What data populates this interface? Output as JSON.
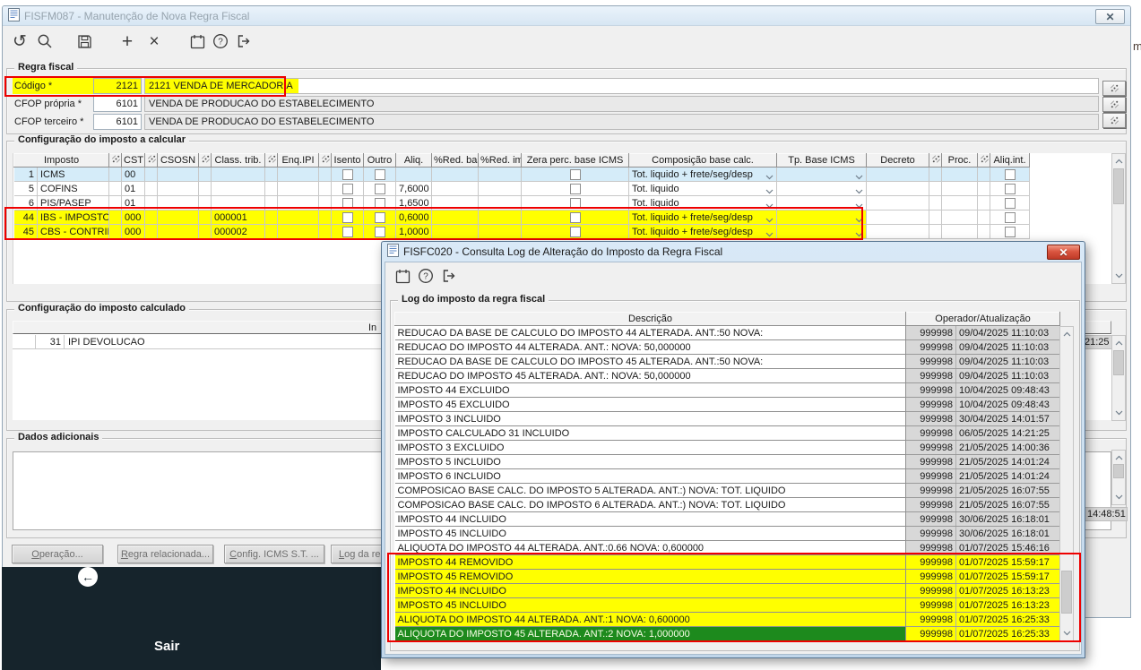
{
  "background": {
    "fragment_text": "m"
  },
  "window": {
    "title": "FISFM087 - Manutenção de Nova Regra Fiscal"
  },
  "main_toolbar": {
    "icons": [
      "undo",
      "search",
      "save",
      "add",
      "delete-x",
      "calendar",
      "help",
      "exit"
    ]
  },
  "regra_fiscal": {
    "group_label": "Regra fiscal",
    "fields": [
      {
        "label": "Código *",
        "code": "2121",
        "desc": "2121 VENDA DE MERCADORIA",
        "highlight": true
      },
      {
        "label": "CFOP própria *",
        "code": "6101",
        "desc": "VENDA DE PRODUCAO DO ESTABELECIMENTO",
        "highlight": false
      },
      {
        "label": "CFOP terceiro *",
        "code": "6101",
        "desc": "VENDA DE PRODUCAO DO ESTABELECIMENTO",
        "highlight": false
      }
    ]
  },
  "imposto_calcular": {
    "group_label": "Configuração do imposto a calcular",
    "columns": [
      "Imposto",
      "CST",
      "CSOSN",
      "Class. trib.",
      "Enq.IPI",
      "Isento",
      "Outro",
      "Aliq.",
      "%Red. base",
      "%Red. imp",
      "Zera perc. base ICMS",
      "Composição base calc.",
      "Tp. Base ICMS",
      "Decreto",
      "Proc.",
      "Aliq.int."
    ],
    "rows": [
      {
        "num": "1",
        "imposto": "ICMS",
        "cst": "00",
        "csosn": "",
        "class_trib": "",
        "enq_ipi": "",
        "aliq": "",
        "red_base": "",
        "red_imp": "",
        "comp": "Tot. liquido + frete/seg/desp",
        "decreto": "",
        "proc": "",
        "state": "selected"
      },
      {
        "num": "5",
        "imposto": "COFINS",
        "cst": "01",
        "csosn": "",
        "class_trib": "",
        "enq_ipi": "",
        "aliq": "7,6000",
        "red_base": "",
        "red_imp": "",
        "comp": "Tot. liquido",
        "decreto": "",
        "proc": "",
        "state": "normal"
      },
      {
        "num": "6",
        "imposto": "PIS/PASEP",
        "cst": "01",
        "csosn": "",
        "class_trib": "",
        "enq_ipi": "",
        "aliq": "1,6500",
        "red_base": "",
        "red_imp": "",
        "comp": "Tot. liquido",
        "decreto": "",
        "proc": "",
        "state": "normal"
      },
      {
        "num": "44",
        "imposto": "IBS - IMPOSTO SC",
        "cst": "000",
        "csosn": "",
        "class_trib": "000001",
        "enq_ipi": "",
        "aliq": "0,6000",
        "red_base": "",
        "red_imp": "",
        "comp": "Tot. liquido + frete/seg/desp",
        "decreto": "",
        "proc": "",
        "state": "highlight"
      },
      {
        "num": "45",
        "imposto": "CBS - CONTRIBUI(",
        "cst": "000",
        "csosn": "",
        "class_trib": "000002",
        "enq_ipi": "",
        "aliq": "1,0000",
        "red_base": "",
        "red_imp": "",
        "comp": "Tot. liquido + frete/seg/desp",
        "decreto": "",
        "proc": "",
        "state": "highlight"
      }
    ]
  },
  "imposto_calculado": {
    "group_label": "Configuração do imposto calculado",
    "partial_header": "In",
    "rows": [
      {
        "num": "31",
        "nome": "IPI DEVOLUCAO"
      }
    ],
    "fragment_time": "21:25"
  },
  "dados_adicionais": {
    "group_label": "Dados adicionais",
    "text": "",
    "fragment_time": "14:48:51"
  },
  "action_buttons": [
    {
      "label": "Operação..."
    },
    {
      "label": "Regra relacionada..."
    },
    {
      "label": "Config. ICMS S.T. ..."
    },
    {
      "label": "Log da re"
    }
  ],
  "footer": {
    "exit_label": "Sair"
  },
  "dialog": {
    "title": "FISFC020 - Consulta Log de Alteração do Imposto da Regra Fiscal",
    "toolbar_icons": [
      "calendar",
      "help",
      "exit"
    ],
    "group_label": "Log do imposto da regra fiscal",
    "columns": {
      "descricao": "Descrição",
      "operador": "Operador/Atualização"
    },
    "rows": [
      {
        "desc": "REDUCAO DA BASE DE CALCULO DO IMPOSTO 44 ALTERADA. ANT.:50 NOVA:",
        "oper": "999998",
        "data": "09/04/2025 11:10:03",
        "state": "normal"
      },
      {
        "desc": "REDUCAO DO IMPOSTO 44 ALTERADA. ANT.: NOVA: 50,000000",
        "oper": "999998",
        "data": "09/04/2025 11:10:03",
        "state": "normal"
      },
      {
        "desc": "REDUCAO DA BASE DE CALCULO DO IMPOSTO 45 ALTERADA. ANT.:50 NOVA:",
        "oper": "999998",
        "data": "09/04/2025 11:10:03",
        "state": "normal"
      },
      {
        "desc": "REDUCAO DO IMPOSTO 45 ALTERADA. ANT.: NOVA: 50,000000",
        "oper": "999998",
        "data": "09/04/2025 11:10:03",
        "state": "normal"
      },
      {
        "desc": "IMPOSTO 44 EXCLUIDO",
        "oper": "999998",
        "data": "10/04/2025 09:48:43",
        "state": "normal"
      },
      {
        "desc": "IMPOSTO 45 EXCLUIDO",
        "oper": "999998",
        "data": "10/04/2025 09:48:43",
        "state": "normal"
      },
      {
        "desc": "IMPOSTO 3 INCLUIDO",
        "oper": "999998",
        "data": "30/04/2025 14:01:57",
        "state": "normal"
      },
      {
        "desc": "IMPOSTO CALCULADO 31 INCLUIDO",
        "oper": "999998",
        "data": "06/05/2025 14:21:25",
        "state": "normal"
      },
      {
        "desc": "IMPOSTO 3 EXCLUIDO",
        "oper": "999998",
        "data": "21/05/2025 14:00:36",
        "state": "normal"
      },
      {
        "desc": "IMPOSTO 5 INCLUIDO",
        "oper": "999998",
        "data": "21/05/2025 14:01:24",
        "state": "normal"
      },
      {
        "desc": "IMPOSTO 6 INCLUIDO",
        "oper": "999998",
        "data": "21/05/2025 14:01:24",
        "state": "normal"
      },
      {
        "desc": "COMPOSICAO BASE CALC. DO IMPOSTO 5 ALTERADA. ANT.:) NOVA: TOT. LIQUIDO",
        "oper": "999998",
        "data": "21/05/2025 16:07:55",
        "state": "normal"
      },
      {
        "desc": "COMPOSICAO BASE CALC. DO IMPOSTO 6 ALTERADA. ANT.:) NOVA: TOT. LIQUIDO",
        "oper": "999998",
        "data": "21/05/2025 16:07:55",
        "state": "normal"
      },
      {
        "desc": "IMPOSTO 44 INCLUIDO",
        "oper": "999998",
        "data": "30/06/2025 16:18:01",
        "state": "normal"
      },
      {
        "desc": "IMPOSTO 45 INCLUIDO",
        "oper": "999998",
        "data": "30/06/2025 16:18:01",
        "state": "normal"
      },
      {
        "desc": "ALIQUOTA DO IMPOSTO 44 ALTERADA. ANT.:0.66 NOVA: 0,600000",
        "oper": "999998",
        "data": "01/07/2025 15:46:16",
        "state": "normal"
      },
      {
        "desc": "IMPOSTO 44 REMOVIDO",
        "oper": "999998",
        "data": "01/07/2025 15:59:17",
        "state": "highlight"
      },
      {
        "desc": "IMPOSTO 45 REMOVIDO",
        "oper": "999998",
        "data": "01/07/2025 15:59:17",
        "state": "highlight"
      },
      {
        "desc": "IMPOSTO 44 INCLUIDO",
        "oper": "999998",
        "data": "01/07/2025 16:13:23",
        "state": "highlight"
      },
      {
        "desc": "IMPOSTO 45 INCLUIDO",
        "oper": "999998",
        "data": "01/07/2025 16:13:23",
        "state": "highlight"
      },
      {
        "desc": "ALIQUOTA DO IMPOSTO 44 ALTERADA. ANT.:1 NOVA: 0,600000",
        "oper": "999998",
        "data": "01/07/2025 16:25:33",
        "state": "highlight"
      },
      {
        "desc": "ALIQUOTA DO IMPOSTO 45 ALTERADA. ANT.:2 NOVA: 1,000000",
        "oper": "999998",
        "data": "01/07/2025 16:25:33",
        "state": "highlight-selected"
      }
    ]
  }
}
